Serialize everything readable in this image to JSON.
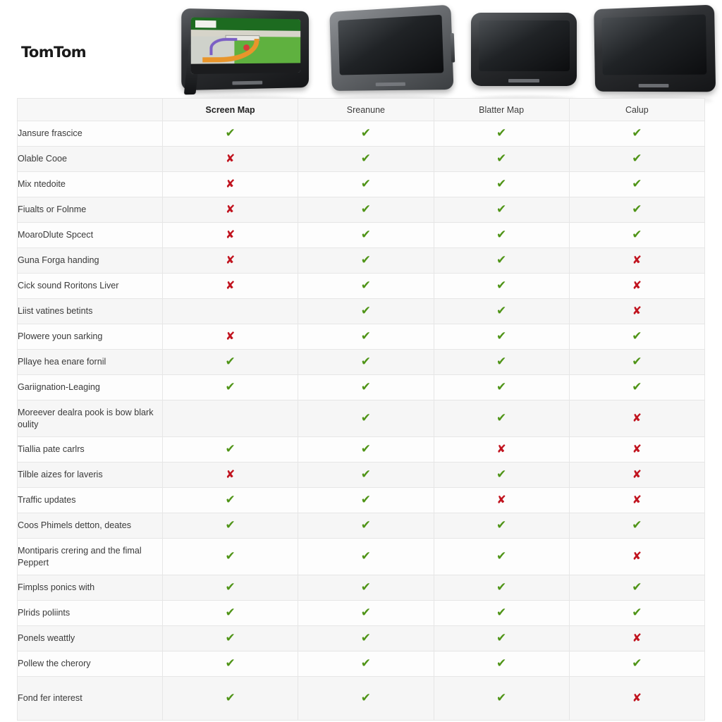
{
  "brand": "TomTom",
  "devices": [
    {
      "name": "gps-device-navigating",
      "caption": ""
    },
    {
      "name": "gps-device-grey-bezel",
      "caption": ""
    },
    {
      "name": "gps-device-small-black",
      "caption": ""
    },
    {
      "name": "gps-device-wide-black",
      "caption": ""
    }
  ],
  "table": {
    "feature_column_header": "",
    "columns": [
      "Screen Map",
      "Sreanune",
      "Blatter Map",
      "Calup"
    ],
    "symbols": {
      "yes": "✔",
      "no": "✘",
      "none": ""
    },
    "colors": {
      "yes": "#4f9417",
      "no": "#c1141f",
      "header_bg": "#f7f7f7",
      "row_alt_bg": "#f6f6f6"
    },
    "rows": [
      {
        "feature": "Jansure frascice",
        "values": [
          "yes",
          "yes",
          "yes",
          "yes"
        ]
      },
      {
        "feature": "Olable Cooe",
        "values": [
          "no",
          "yes",
          "yes",
          "yes"
        ]
      },
      {
        "feature": "Mix ntedoite",
        "values": [
          "no",
          "yes",
          "yes",
          "yes"
        ]
      },
      {
        "feature": "Fiualts or Folnme",
        "values": [
          "no",
          "yes",
          "yes",
          "yes"
        ]
      },
      {
        "feature": "MoaroDlute Spcect",
        "values": [
          "no",
          "yes",
          "yes",
          "yes"
        ]
      },
      {
        "feature": "Guna Forga handing",
        "values": [
          "no",
          "yes",
          "yes",
          "no"
        ]
      },
      {
        "feature": "Cick sound Roritons Liver",
        "values": [
          "no",
          "yes",
          "yes",
          "no"
        ]
      },
      {
        "feature": "Liist vatines betints",
        "values": [
          "none",
          "yes",
          "yes",
          "no"
        ]
      },
      {
        "feature": "Plowere youn sarking",
        "values": [
          "no",
          "yes",
          "yes",
          "yes"
        ]
      },
      {
        "feature": "Pllaye hea enare fornil",
        "values": [
          "yes",
          "yes",
          "yes",
          "yes"
        ]
      },
      {
        "feature": "Gariignation-Leaging",
        "values": [
          "yes",
          "yes",
          "yes",
          "yes"
        ]
      },
      {
        "feature": "Moreever dealra pook is bow blark oulity",
        "values": [
          "none",
          "yes",
          "yes",
          "no"
        ],
        "tall": true
      },
      {
        "feature": "Tiallia pate carlrs",
        "values": [
          "yes",
          "yes",
          "no",
          "no"
        ]
      },
      {
        "feature": "Tilble aizes for laveris",
        "values": [
          "no",
          "yes",
          "yes",
          "no"
        ]
      },
      {
        "feature": "Traffic updates",
        "values": [
          "yes",
          "yes",
          "no",
          "no"
        ]
      },
      {
        "feature": "Coos Phimels detton, deates",
        "values": [
          "yes",
          "yes",
          "yes",
          "yes"
        ]
      },
      {
        "feature": "Montiparis crering and the fimal Peppert",
        "values": [
          "yes",
          "yes",
          "yes",
          "no"
        ],
        "tall": true
      },
      {
        "feature": "Fimplss ponics with",
        "values": [
          "yes",
          "yes",
          "yes",
          "yes"
        ]
      },
      {
        "feature": "Plrids poliints",
        "values": [
          "yes",
          "yes",
          "yes",
          "yes"
        ]
      },
      {
        "feature": "Ponels weattly",
        "values": [
          "yes",
          "yes",
          "yes",
          "no"
        ]
      },
      {
        "feature": "Pollew the cherory",
        "values": [
          "yes",
          "yes",
          "yes",
          "yes"
        ]
      },
      {
        "feature": "Fond fer interest",
        "values": [
          "yes",
          "yes",
          "yes",
          "no"
        ],
        "tall_last": true
      }
    ]
  }
}
